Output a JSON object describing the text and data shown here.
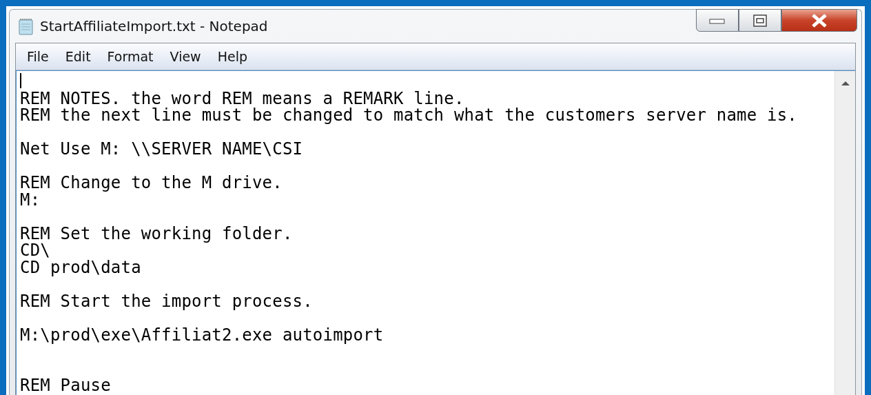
{
  "window": {
    "title": "StartAffiliateImport.txt - Notepad"
  },
  "menu": [
    {
      "label": "File"
    },
    {
      "label": "Edit"
    },
    {
      "label": "Format"
    },
    {
      "label": "View"
    },
    {
      "label": "Help"
    }
  ],
  "document": {
    "text": "REM NOTES. the word REM means a REMARK line.\nREM the next line must be changed to match what the customers server name is.\n\nNet Use M: \\\\SERVER NAME\\CSI\n\nREM Change to the M drive.\nM:\n\nREM Set the working folder.\nCD\\\nCD prod\\data\n\nREM Start the import process.\n\nM:\\prod\\exe\\Affiliat2.exe autoimport\n\n\nREM Pause"
  }
}
